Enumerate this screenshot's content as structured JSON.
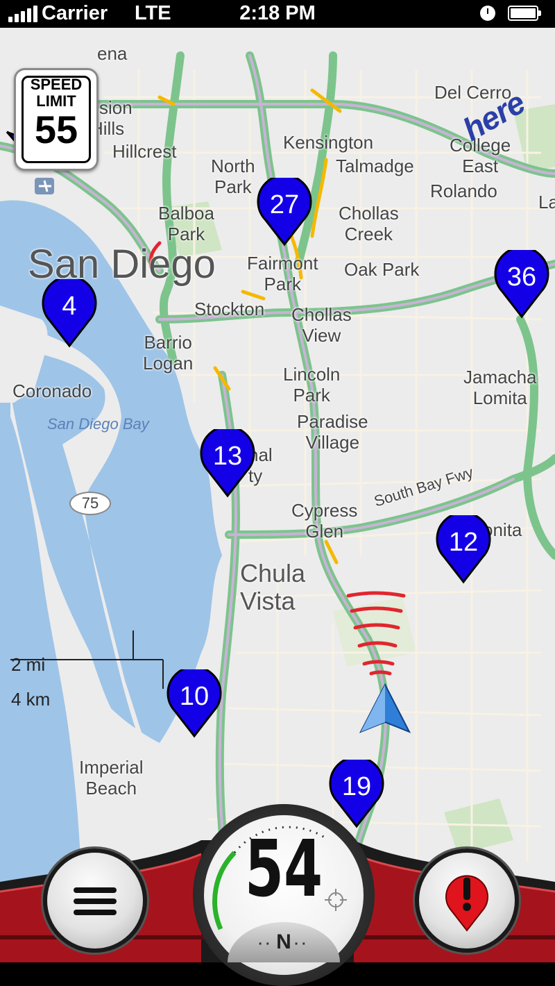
{
  "status_bar": {
    "carrier": "Carrier",
    "network": "LTE",
    "time": "2:18 PM",
    "icons": [
      "signal-icon",
      "clock-icon",
      "battery-icon"
    ]
  },
  "speed_limit_sign": {
    "line1": "SPEED",
    "line2": "LIMIT",
    "value": "55"
  },
  "brand_logo": "here",
  "map": {
    "region_label": "San Diego",
    "water_label": "San Diego Bay",
    "highway_shield": "75",
    "road_label": "South Bay Fwy",
    "labels": {
      "mission_hills": "ssion\nHills",
      "hillcrest": "Hillcrest",
      "kensington": "Kensington",
      "del_cerro": "Del Cerro",
      "college_east": "College\nEast",
      "talmadge": "Talmadge",
      "north_park": "North\nPark",
      "rolando": "Rolando",
      "balboa_park": "Balboa\nPark",
      "chollas_creek": "Chollas\nCreek",
      "fairmont_park": "Fairmont\nPark",
      "oak_park": "Oak Park",
      "stockton": "Stockton",
      "chollas_view": "Chollas\nView",
      "barrio_logan": "Barrio\nLogan",
      "coronado": "Coronado",
      "lincoln_park": "Lincoln\nPark",
      "jamacha_lomita": "Jamacha\nLomita",
      "paradise_village": "Paradise\nVillage",
      "national_city": "nal\nty",
      "cypress_glen": "Cypress\nGlen",
      "bonita": "onita",
      "chula_vista": "Chula\nVista",
      "imperial_beach": "Imperial\nBeach",
      "partial_top": "ena",
      "partial_right": "La"
    },
    "markers": [
      "4",
      "27",
      "36",
      "13",
      "12",
      "10",
      "19"
    ],
    "scale": {
      "miles": "2 mi",
      "kilometers": "4 km"
    }
  },
  "dashboard": {
    "speed": "54",
    "heading": "N",
    "icons": [
      "menu-icon",
      "alert-icon",
      "target-icon"
    ]
  },
  "colors": {
    "marker": "#1400e6",
    "freeway": "#7cc48c",
    "water": "#9ec4e8",
    "traffic_slow": "#f5b800",
    "traffic_jam": "#e0262e",
    "dash_red": "#a5141c"
  }
}
